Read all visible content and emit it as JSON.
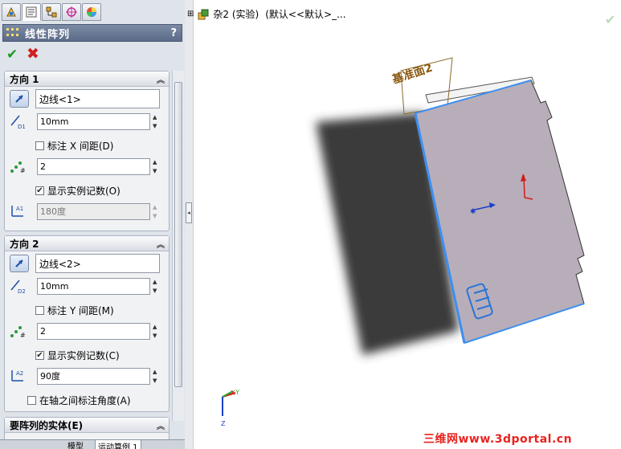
{
  "property_manager": {
    "tabs": [
      "feature-manager-tab",
      "property-manager-tab",
      "configuration-manager-tab",
      "dimxpert-tab",
      "display-manager-tab"
    ],
    "title": "线性阵列",
    "help_label": "?",
    "direction1": {
      "heading": "方向 1",
      "edge": "边线<1>",
      "spacing": "10mm",
      "dim_spacing_label": "标注 X 间距(D)",
      "dim_spacing_checked": false,
      "count": "2",
      "show_count_label": "显示实例记数(O)",
      "show_count_checked": true,
      "angle": "180度"
    },
    "direction2": {
      "heading": "方向 2",
      "edge": "边线<2>",
      "spacing": "10mm",
      "dim_spacing_label": "标注 Y 间距(M)",
      "dim_spacing_checked": false,
      "count": "2",
      "show_count_label": "显示实例记数(C)",
      "show_count_checked": true,
      "angle": "90度",
      "axis_angle_label": "在轴之间标注角度(A)",
      "axis_angle_checked": false
    },
    "bodies_heading": "要阵列的实体(E)",
    "bottom_tabs": [
      "模型",
      "运动算例 1"
    ]
  },
  "viewport": {
    "tree_label": "杂2 (实验)",
    "tree_config": "(默认<<默认>_...",
    "plane_label": "基准面2",
    "triad_labels": [
      "X",
      "Y",
      "Z"
    ],
    "watermark": "三维网www.3dportal.cn"
  },
  "colors": {
    "header": "#5b6b88",
    "part_face": "#b7aeb8",
    "shadow": "#3a3a3a",
    "highlight_edge": "#3d8ff0",
    "watermark": "#e8231e"
  }
}
